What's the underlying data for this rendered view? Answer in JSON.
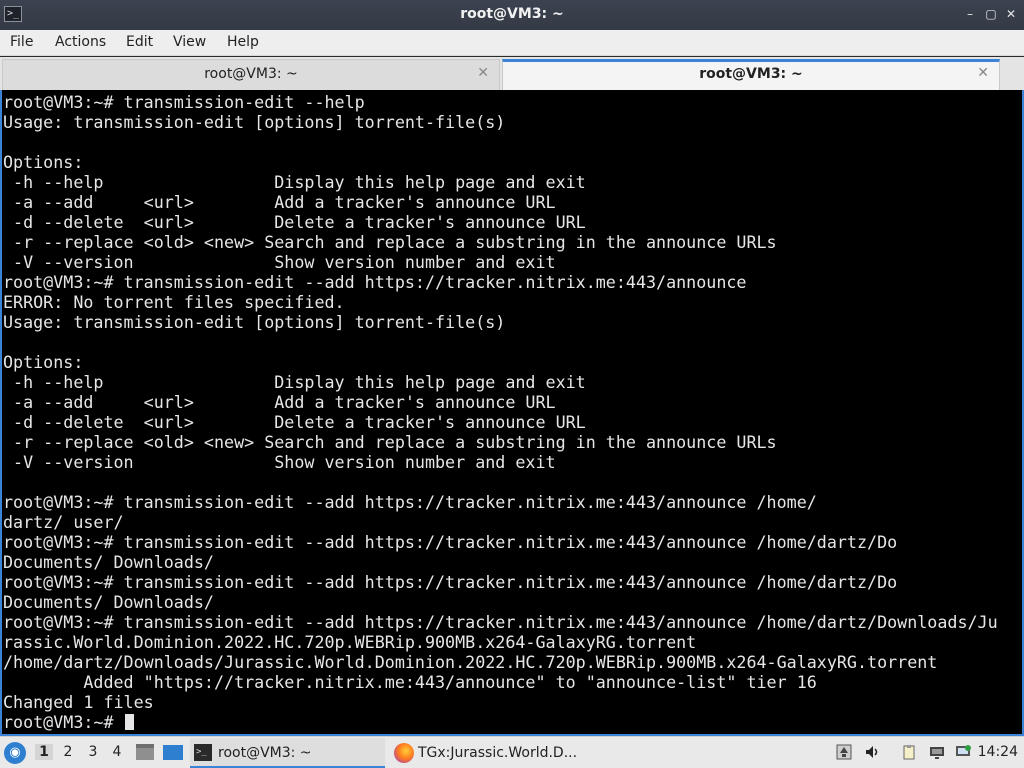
{
  "window": {
    "title": "root@VM3: ~",
    "app_icon_glyph": ">_",
    "controls": {
      "minimize": "–",
      "maximize": "▢",
      "close": "✕"
    }
  },
  "menubar": {
    "items": [
      "File",
      "Actions",
      "Edit",
      "View",
      "Help"
    ]
  },
  "tabs": [
    {
      "label": "root@VM3: ~",
      "active": false,
      "close": "✕"
    },
    {
      "label": "root@VM3: ~",
      "active": true,
      "close": "✕"
    }
  ],
  "terminal": {
    "lines": [
      "root@VM3:~# transmission-edit --help",
      "Usage: transmission-edit [options] torrent-file(s)",
      "",
      "Options:",
      " -h --help                 Display this help page and exit",
      " -a --add     <url>        Add a tracker's announce URL",
      " -d --delete  <url>        Delete a tracker's announce URL",
      " -r --replace <old> <new> Search and replace a substring in the announce URLs",
      " -V --version              Show version number and exit",
      "root@VM3:~# transmission-edit --add https://tracker.nitrix.me:443/announce",
      "ERROR: No torrent files specified.",
      "Usage: transmission-edit [options] torrent-file(s)",
      "",
      "Options:",
      " -h --help                 Display this help page and exit",
      " -a --add     <url>        Add a tracker's announce URL",
      " -d --delete  <url>        Delete a tracker's announce URL",
      " -r --replace <old> <new> Search and replace a substring in the announce URLs",
      " -V --version              Show version number and exit",
      "",
      "root@VM3:~# transmission-edit --add https://tracker.nitrix.me:443/announce /home/",
      "dartz/ user/",
      "root@VM3:~# transmission-edit --add https://tracker.nitrix.me:443/announce /home/dartz/Do",
      "Documents/ Downloads/",
      "root@VM3:~# transmission-edit --add https://tracker.nitrix.me:443/announce /home/dartz/Do",
      "Documents/ Downloads/",
      "root@VM3:~# transmission-edit --add https://tracker.nitrix.me:443/announce /home/dartz/Downloads/Ju",
      "rassic.World.Dominion.2022.HC.720p.WEBRip.900MB.x264-GalaxyRG.torrent",
      "/home/dartz/Downloads/Jurassic.World.Dominion.2022.HC.720p.WEBRip.900MB.x264-GalaxyRG.torrent",
      "        Added \"https://tracker.nitrix.me:443/announce\" to \"announce-list\" tier 16",
      "Changed 1 files"
    ],
    "prompt": "root@VM3:~# "
  },
  "taskbar": {
    "start_glyph": "◉",
    "workspaces": [
      "1",
      "2",
      "3",
      "4"
    ],
    "current_workspace": "1",
    "tasks": [
      {
        "label": "root@VM3: ~",
        "icon": "terminal-icon",
        "active": true
      },
      {
        "label": "TGx:Jurassic.World.D...",
        "icon": "firefox-icon",
        "active": false
      }
    ],
    "tray_icons": [
      "updates-icon",
      "volume-icon",
      "clipboard-icon",
      "display-icon",
      "network-icon"
    ],
    "clock": "14:24"
  }
}
